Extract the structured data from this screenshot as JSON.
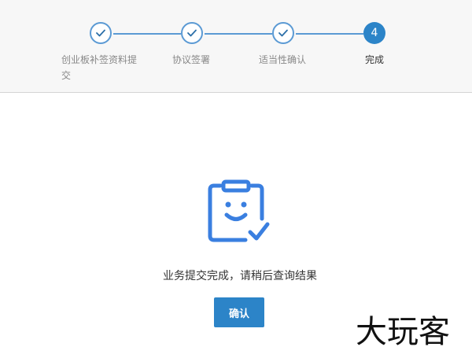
{
  "colors": {
    "accent": "#2c84c8",
    "step_line": "#5b9ad4",
    "icon_blue": "#3a7fe0",
    "stepper_bg": "#f7f7f7"
  },
  "steps": [
    {
      "label": "创业板补签资料提交",
      "status": "done",
      "icon": "check-icon"
    },
    {
      "label": "协议签署",
      "status": "done",
      "icon": "check-icon"
    },
    {
      "label": "适当性确认",
      "status": "done",
      "icon": "check-icon"
    },
    {
      "label": "完成",
      "status": "active",
      "number": "4"
    }
  ],
  "result": {
    "icon": "clipboard-smile-check-icon",
    "message": "业务提交完成，请稍后查询结果",
    "confirm_label": "确认"
  },
  "watermark": {
    "text": "大玩客"
  }
}
